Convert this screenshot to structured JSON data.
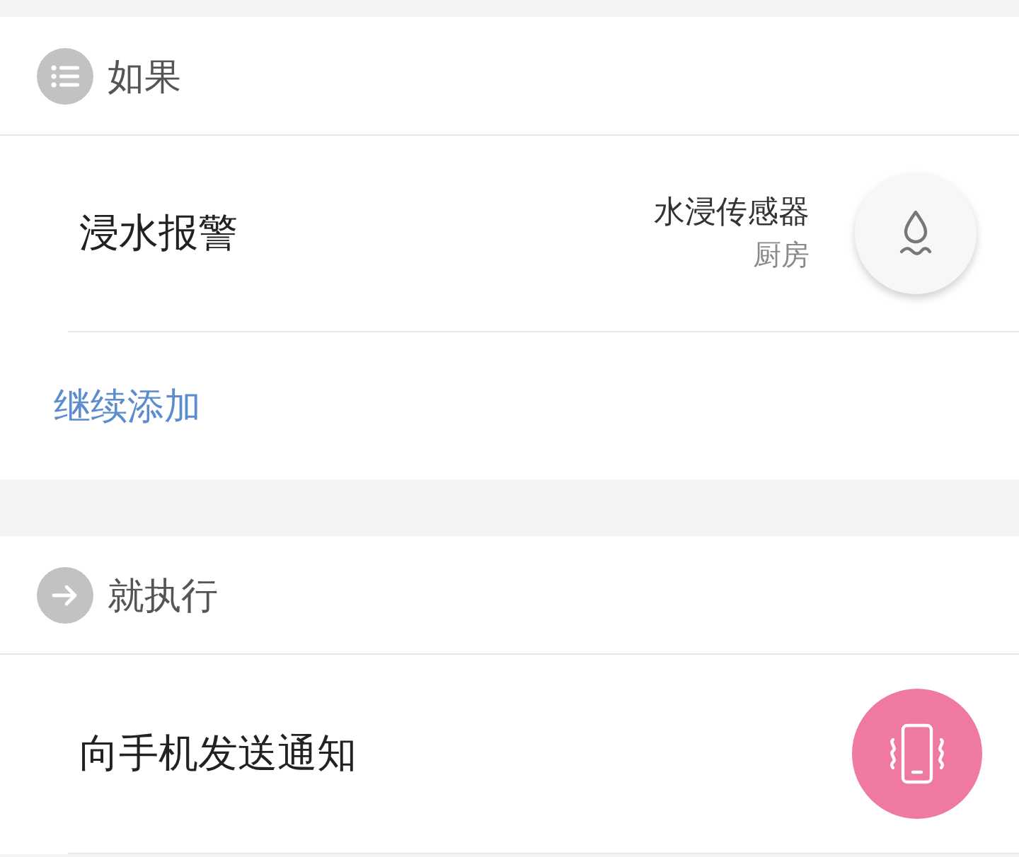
{
  "sections": [
    {
      "kind": "condition",
      "title": "如果",
      "rows": [
        {
          "kind": "device",
          "label": "浸水报警",
          "device_name": "水浸传感器",
          "device_room": "厨房"
        }
      ],
      "add_link": "继续添加"
    },
    {
      "kind": "action",
      "title": "就执行",
      "rows": [
        {
          "kind": "notify",
          "label": "向手机发送通知"
        }
      ]
    }
  ]
}
